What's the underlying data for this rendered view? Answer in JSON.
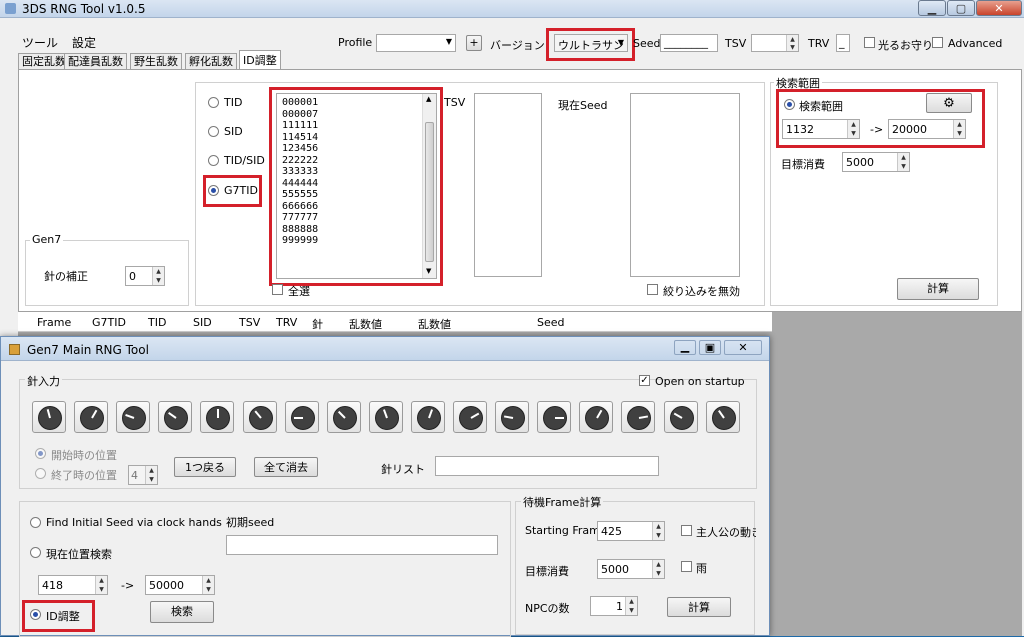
{
  "main": {
    "title": "3DS RNG Tool v1.0.5",
    "menu": [
      "ツール",
      "設定"
    ],
    "profile_label": "Profile",
    "plus_label": "+",
    "version_label": "バージョン",
    "version_value": "ウルトラサン",
    "seed_label": "Seed",
    "seed_value": "________",
    "tsv_label": "TSV",
    "trv_label": "TRV",
    "trv_value": "_",
    "shiny_charm_label": "光るお守り",
    "advanced_label": "Advanced",
    "tabs": [
      "固定乱数",
      "配達員乱数",
      "野生乱数",
      "孵化乱数",
      "ID調整"
    ],
    "radios": [
      "TID",
      "SID",
      "TID/SID",
      "G7TID"
    ],
    "id_list": [
      "000001",
      "000007",
      "111111",
      "114514",
      "123456",
      "222222",
      "333333",
      "444444",
      "555555",
      "666666",
      "777777",
      "888888",
      "999999"
    ],
    "tsv_list_label": "TSV",
    "current_seed_label": "現在Seed",
    "scan_label": "全選",
    "disable_filter_label": "絞り込みを無効",
    "search_range_group": "検索範囲",
    "search_range_radio": "検索範囲",
    "range_from": "1132",
    "range_arrow": "->",
    "range_to": "20000",
    "target_consume_label": "目標消費",
    "target_consume_value": "5000",
    "calc_label": "計算",
    "gen7_group": "Gen7",
    "needle_correction_label": "針の補正",
    "needle_correction_value": "0",
    "table_headers": [
      "Frame",
      "G7TID",
      "TID",
      "SID",
      "TSV",
      "TRV",
      "針",
      "乱数値",
      "乱数値",
      "Seed"
    ]
  },
  "sub": {
    "title": "Gen7 Main RNG Tool",
    "needle_input_group": "針入力",
    "open_on_startup_label": "Open on startup",
    "needle_angles": [
      -15,
      30,
      -70,
      -55,
      0,
      -40,
      -90,
      -45,
      -20,
      20,
      60,
      -80,
      90,
      30,
      80,
      -60,
      -35
    ],
    "start_pos_label": "開始時の位置",
    "end_pos_label": "終了時の位置",
    "end_pos_value": "4",
    "back_one_label": "1つ戻る",
    "clear_all_label": "全て消去",
    "needle_list_label": "針リスト",
    "find_initial_seed_label": "Find Initial Seed via clock hands",
    "initial_seed_label": "初期seed",
    "current_pos_search_label": "現在位置検索",
    "range_from": "418",
    "range_arrow": "->",
    "range_to": "50000",
    "id_adjust_label": "ID調整",
    "search_label": "検索",
    "wait_frame_group": "待機Frame計算",
    "starting_frame_label": "Starting Frame",
    "starting_frame_value": "425",
    "player_move_label": "主人公の動き",
    "target_consume_label": "目標消費",
    "target_consume_value": "5000",
    "rain_label": "雨",
    "npc_count_label": "NPCの数",
    "npc_count_value": "1",
    "calc_label": "計算"
  }
}
